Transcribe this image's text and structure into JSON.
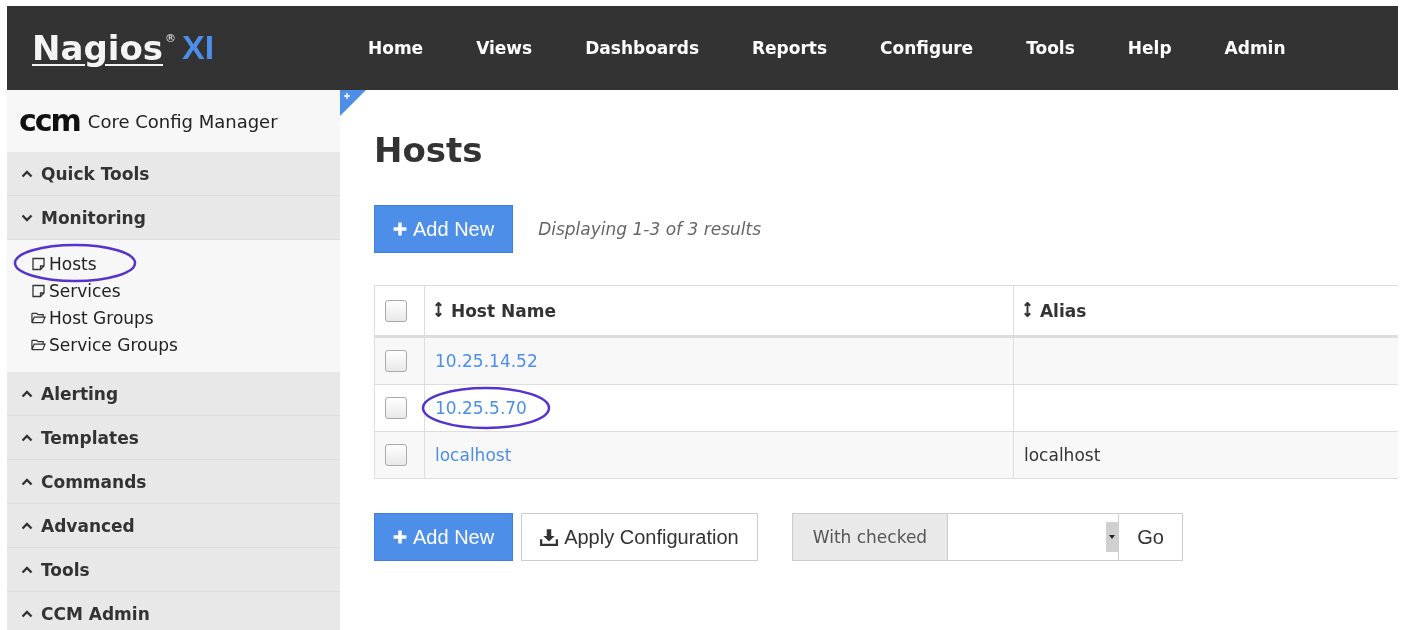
{
  "header": {
    "logo": {
      "name": "Nagios",
      "mark": "®",
      "suffix": "XI"
    },
    "nav": [
      "Home",
      "Views",
      "Dashboards",
      "Reports",
      "Configure",
      "Tools",
      "Help",
      "Admin"
    ]
  },
  "sidebar": {
    "logo": "ccm",
    "title": "Core Config Manager",
    "sections": [
      {
        "label": "Quick Tools",
        "expanded": false
      },
      {
        "label": "Monitoring",
        "expanded": true,
        "children": [
          {
            "label": "Hosts",
            "kind": "page",
            "circled": true
          },
          {
            "label": "Services",
            "kind": "page",
            "circled": false
          },
          {
            "label": "Host Groups",
            "kind": "folder",
            "circled": false
          },
          {
            "label": "Service Groups",
            "kind": "folder",
            "circled": false
          }
        ]
      },
      {
        "label": "Alerting",
        "expanded": false
      },
      {
        "label": "Templates",
        "expanded": false
      },
      {
        "label": "Commands",
        "expanded": false
      },
      {
        "label": "Advanced",
        "expanded": false
      },
      {
        "label": "Tools",
        "expanded": false
      },
      {
        "label": "CCM Admin",
        "expanded": false
      }
    ]
  },
  "main": {
    "title": "Hosts",
    "add_button": "Add New",
    "results": "Displaying 1-3 of 3 results",
    "table": {
      "select_all": {
        "checked": false
      },
      "columns": [
        "Host Name",
        "Alias"
      ],
      "rows": [
        {
          "checked": false,
          "host": "10.25.14.52",
          "circled": false
        },
        {
          "checked": false,
          "host": "10.25.5.70",
          "circled": true
        },
        {
          "checked": false,
          "host": "localhost",
          "alias": "localhost",
          "circled": false
        }
      ]
    },
    "footer": {
      "add_button": "Add New",
      "apply_button": "Apply Configuration",
      "with_checked": "With checked",
      "go_button": "Go"
    }
  }
}
